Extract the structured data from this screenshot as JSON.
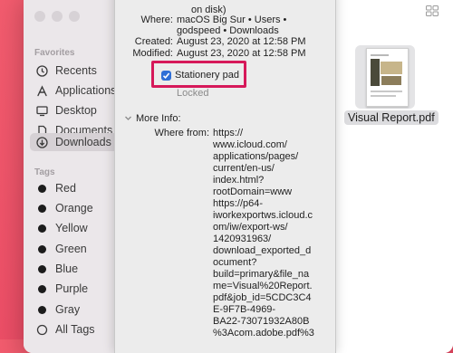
{
  "sidebar": {
    "favorites_heading": "Favorites",
    "favorites": [
      {
        "label": "Recents",
        "icon": "clock-icon"
      },
      {
        "label": "Applications",
        "icon": "applications-icon"
      },
      {
        "label": "Desktop",
        "icon": "desktop-icon"
      },
      {
        "label": "Documents",
        "icon": "document-icon"
      },
      {
        "label": "Downloads",
        "icon": "download-icon",
        "selected": true
      }
    ],
    "tags_heading": "Tags",
    "tags": [
      {
        "label": "Red"
      },
      {
        "label": "Orange"
      },
      {
        "label": "Yellow"
      },
      {
        "label": "Green"
      },
      {
        "label": "Blue"
      },
      {
        "label": "Purple"
      },
      {
        "label": "Gray"
      },
      {
        "label": "All Tags"
      }
    ]
  },
  "file": {
    "name": "Visual Report.pdf"
  },
  "info": {
    "size_tail": "on disk)",
    "where_label": "Where:",
    "where_value": "macOS Big Sur • Users •",
    "where_value_2": "godspeed • Downloads",
    "created_label": "Created:",
    "created_value": "August 23, 2020 at 12:58 PM",
    "modified_label": "Modified:",
    "modified_value": "August 23, 2020 at 12:58 PM",
    "stationery_label": "Stationery pad",
    "stationery_checked": true,
    "locked_label": "Locked",
    "more_info_label": "More Info:",
    "where_from_label": "Where from:",
    "where_from_lines": [
      "https://",
      "www.icloud.com/",
      "applications/pages/",
      "current/en-us/",
      "index.html?",
      "rootDomain=www",
      "https://p64-",
      "iworkexportws.icloud.c",
      "om/iw/export-ws/",
      "1420931963/",
      "download_exported_d",
      "ocument?",
      "build=primary&file_na",
      "me=Visual%20Report.",
      "pdf&job_id=5CDC3C4",
      "E-9F7B-4969-",
      "BA22-73071932A80B",
      "%3Acom.adobe.pdf%3"
    ]
  },
  "colors": {
    "background": "#ea4a64",
    "highlight": "#d6195a",
    "checkbox": "#2f6fd6"
  }
}
